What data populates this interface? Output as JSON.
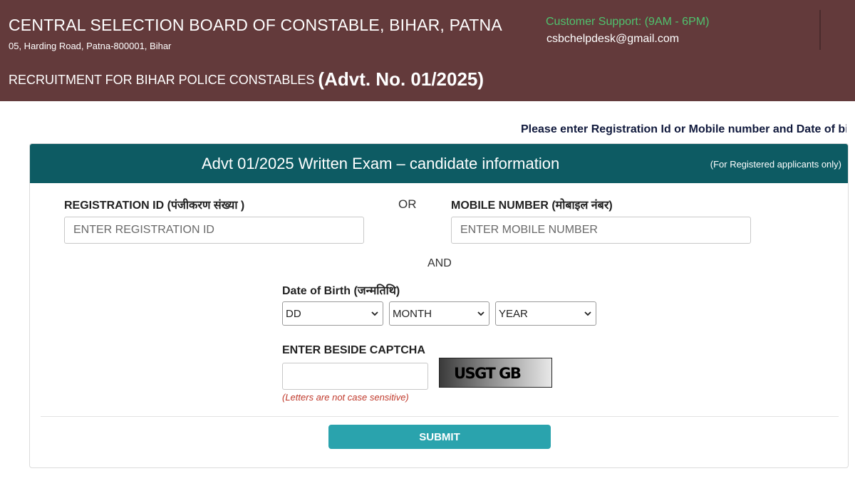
{
  "header": {
    "title": "CENTRAL SELECTION BOARD OF CONSTABLE, BIHAR, PATNA",
    "address": "05, Harding Road, Patna-800001, Bihar",
    "recruitment": "RECRUITMENT FOR BIHAR POLICE CONSTABLES",
    "advt_no": "(Advt. No. 01/2025)",
    "support_label": "Customer Support: (9AM - 6PM)",
    "support_email": "csbchelpdesk@gmail.com"
  },
  "marquee": "Please enter Registration Id or Mobile number and Date of bi",
  "form": {
    "title": "Advt 01/2025 Written Exam – candidate information",
    "note": "(For Registered applicants only)",
    "registration_label": "REGISTRATION ID (पंजीकरण संख्या )",
    "registration_placeholder": "ENTER REGISTRATION ID",
    "or_text": "OR",
    "mobile_label": "MOBILE NUMBER (मोबाइल नंबर)",
    "mobile_placeholder": "ENTER MOBILE NUMBER",
    "and_text": "AND",
    "dob_label": "Date of Birth (जन्मतिथि)",
    "dob_day": "DD",
    "dob_month": "MONTH",
    "dob_year": "YEAR",
    "captcha_label": "ENTER BESIDE CAPTCHA",
    "captcha_value": "",
    "captcha_image_text": "USGT GB",
    "captcha_hint": "(Letters are not case sensitive)",
    "submit_label": "SUBMIT"
  },
  "colors": {
    "header_bg": "#633a3b",
    "support_text": "#4fc26e",
    "card_header_bg": "#0d5b63",
    "submit_bg": "#2aa3ad",
    "hint_text": "#c0392b"
  },
  "icons": {
    "select_chevron": "chevron-down-icon"
  }
}
